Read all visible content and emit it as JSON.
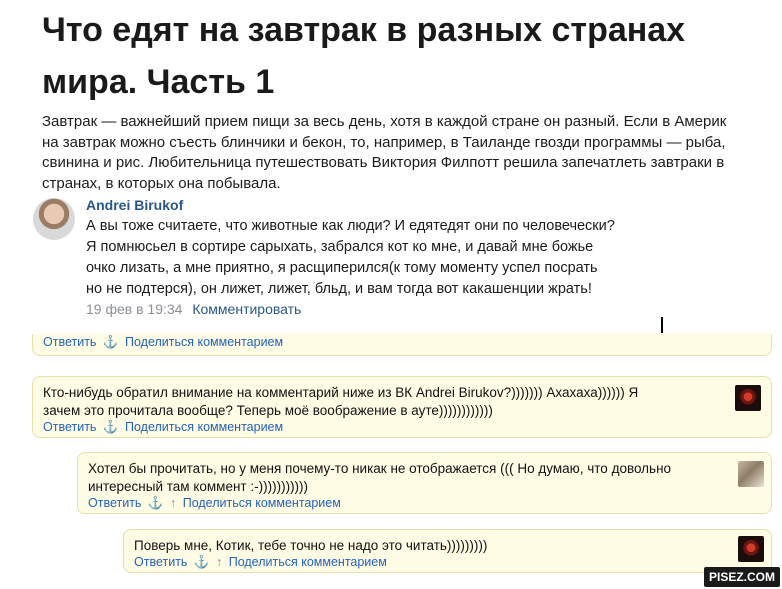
{
  "article": {
    "title": "Что едят на завтрак в разных странах мира. Часть 1",
    "lead": "Завтрак — важнейший прием пищи за весь день, хотя в каждой стране он разный. Если в Америк\nна завтрак можно съесть блинчики и бекон, то, например, в Таиланде гвозди программы — рыба,\nсвинина и рис. Любительница путешествовать Виктория Филпотт решила запечатлеть завтраки в\nстранах, в которых она побывала."
  },
  "vk_comment": {
    "author": "Andrei Birukof",
    "text": "А вы тоже считаете, что животные как люди? И едятедят они по человечески?\nЯ помнюсьел в сортире сарыхать, забрался кот ко мне, и давай мне божье\nочко лизать, а мне приятно, я расщиперился(к тому моменту успел посрать\nно не подтерся), он лижет, лижет, бльд, и вам тогда вот какашенции жрать!",
    "date": "19 фев в 19:34",
    "reply_label": "Комментировать"
  },
  "cut_comment": {
    "reply": "Ответить",
    "anchor": "⚓",
    "share": "Поделиться комментарием"
  },
  "comments": [
    {
      "text": "Кто-нибудь обратил внимание на комментарий ниже из ВК Andrei Birukov?))))))) Ахахаха)))))) Я\nзачем это прочитала вообще? Теперь моё воображение в ауте))))))))))))",
      "reply": "Ответить",
      "anchor": "⚓",
      "share": "Поделиться комментарием"
    },
    {
      "text": "Хотел бы прочитать, но у меня почему-то никак не отображается ((( Но думаю, что довольно\nинтересный там коммент :-)))))))))))",
      "reply": "Ответить",
      "anchor": "⚓",
      "up": "↑",
      "share": "Поделиться комментарием"
    },
    {
      "text": "Поверь мне, Котик, тебе точно не надо это читать)))))))))",
      "reply": "Ответить",
      "anchor": "⚓",
      "up": "↑",
      "share": "Поделиться комментарием"
    }
  ],
  "watermark": "PISEZ.COM",
  "colors": {
    "link": "#2563b8",
    "vk_link": "#2a5885",
    "comment_bg": "#fffce6",
    "comment_border": "#e6dfae"
  }
}
